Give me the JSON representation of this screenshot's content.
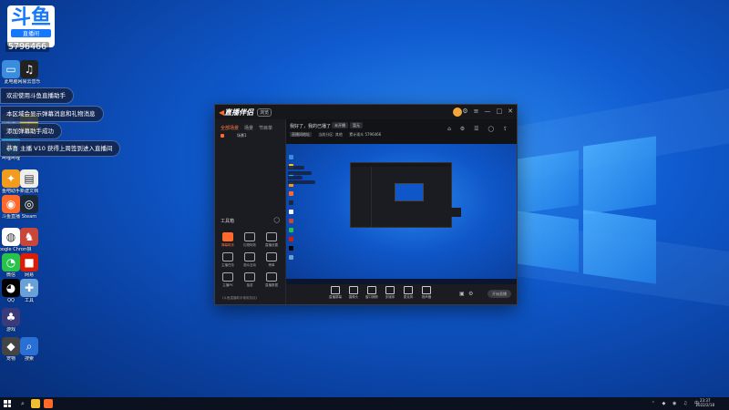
{
  "desktop": {
    "badge": {
      "big": "斗鱼",
      "sub": "直播间"
    },
    "room_id": "5796466",
    "icons": [
      {
        "name": "this-pc",
        "label": "此电脑",
        "color": "#3a8dde",
        "glyph": "▭"
      },
      {
        "name": "music",
        "label": "网易云音乐",
        "color": "#222",
        "glyph": "♫"
      },
      {
        "name": "recycle",
        "label": "回收站",
        "color": "#5a7aa0",
        "glyph": "♲"
      },
      {
        "name": "qqmusic",
        "label": "QQ音乐",
        "color": "#f5c518",
        "glyph": "♪"
      },
      {
        "name": "bilibili",
        "label": "哔哩哔哩",
        "color": "#23ade5",
        "glyph": "▶"
      },
      {
        "name": "fishtool",
        "label": "鱼吧助手",
        "color": "#f29c1f",
        "glyph": "✦"
      },
      {
        "name": "doc",
        "label": "新建文档",
        "color": "#eee",
        "glyph": "▤"
      },
      {
        "name": "douyu",
        "label": "斗鱼直播",
        "color": "#ff6a2a",
        "glyph": "◉"
      },
      {
        "name": "steam",
        "label": "Steam",
        "color": "#1b2838",
        "glyph": "◎"
      },
      {
        "name": "chrome",
        "label": "Google Chrome",
        "color": "#ffffff",
        "glyph": "◍"
      },
      {
        "name": "wolf",
        "label": "狼",
        "color": "#c8463a",
        "glyph": "♞"
      },
      {
        "name": "wechat",
        "label": "微信",
        "color": "#27c24c",
        "glyph": "◔"
      },
      {
        "name": "netease",
        "label": "网易",
        "color": "#d81e06",
        "glyph": "■"
      },
      {
        "name": "qq",
        "label": "QQ",
        "color": "#000",
        "glyph": "◕"
      },
      {
        "name": "tools",
        "label": "工具",
        "color": "#6aa0d8",
        "glyph": "✚"
      },
      {
        "name": "game",
        "label": "游戏",
        "color": "#3b3b7a",
        "glyph": "♣"
      },
      {
        "name": "pet",
        "label": "宠物",
        "color": "#444",
        "glyph": "◆"
      },
      {
        "name": "search",
        "label": "搜索",
        "color": "#2a6fd6",
        "glyph": "⌕"
      }
    ]
  },
  "toasts": [
    "欢迎使用斗鱼直播助手",
    "本区域会显示弹幕消息和礼物消息",
    "添加弹幕助手成功",
    "恭喜 主播 V10 获得上周签到进入直播间"
  ],
  "app": {
    "logo": "直播伴侣",
    "version": "浏览",
    "window_controls": [
      "⚙",
      "≡",
      "—",
      "□",
      "✕"
    ],
    "sidebar_tabs": [
      "全部场景",
      "场景",
      "节目单"
    ],
    "scene_item": "场景1",
    "tools_title": "工具箱",
    "tools": [
      {
        "name": "danmu",
        "label": "弹幕助手",
        "hot": true
      },
      {
        "name": "gift",
        "label": "礼物特效",
        "hot": false
      },
      {
        "name": "setting",
        "label": "直播设置",
        "hot": false
      },
      {
        "name": "record",
        "label": "主播任务",
        "hot": false
      },
      {
        "name": "audience",
        "label": "观众互动",
        "hot": false
      },
      {
        "name": "rank",
        "label": "榜单",
        "hot": false
      },
      {
        "name": "pk",
        "label": "主播PK",
        "hot": false
      },
      {
        "name": "lottery",
        "label": "抽奖",
        "hot": false
      },
      {
        "name": "data",
        "label": "直播数据",
        "hot": false
      }
    ],
    "footer": "《斗鱼直播助手使用协议》",
    "main_title": "我好了，我的已播了",
    "pills": [
      "未开播",
      "暂无"
    ],
    "row2": [
      "直播间地址",
      "当前分区: 其他",
      "累计观众 5796466"
    ],
    "top_icons": "⌂ ⚙ ☰ ◯ ⇪",
    "controls": [
      {
        "name": "screen",
        "label": "直播屏幕"
      },
      {
        "name": "camera",
        "label": "摄像头"
      },
      {
        "name": "window",
        "label": "窗口捕获"
      },
      {
        "name": "media",
        "label": "多媒体"
      },
      {
        "name": "mic",
        "label": "麦克风"
      },
      {
        "name": "speaker",
        "label": "扬声器"
      }
    ],
    "go_live": "开始直播"
  },
  "taskbar": {
    "tray": "⌃ ◆ ◉ ♫ 中",
    "time": "23:37",
    "date": "2022/2/18"
  }
}
